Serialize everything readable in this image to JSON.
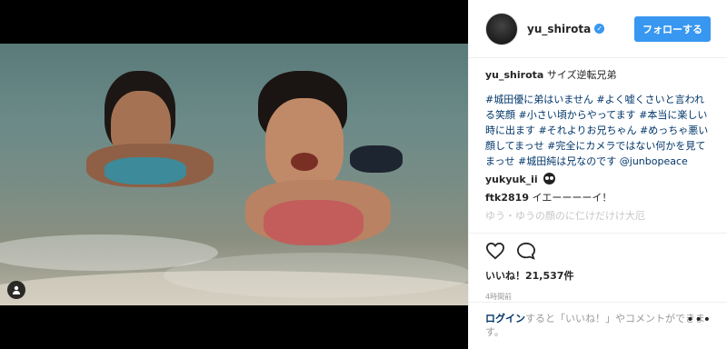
{
  "post": {
    "username": "yu_shirota",
    "verified_icon": "verified-check-icon",
    "follow_label": "フォローする",
    "caption_user": "yu_shirota",
    "caption_text": " サイズ逆転兄弟",
    "hashtags": "#城田優に弟はいません #よく嘘くさいと言われる笑顔 #小さい頃からやってます #本当に楽しい時に出ます #それよりお兄ちゃん #めっちゃ悪い顔してまっせ #完全にカメラではない何かを見てまっせ #城田純は兄なのです @junbopeace",
    "comments": [
      {
        "user": "yukyuk_ii",
        "text": "",
        "emoji": "grinning-face-emoji"
      },
      {
        "user": "ftk2819",
        "text": " イエーーーーイ！"
      },
      {
        "user": "",
        "text": "ゆう・ゆうの顔のに仁けだけけ大厄"
      }
    ],
    "likes_label": "いいね！21,537件",
    "time_ago": "4時間前",
    "login_link": "ログイン",
    "login_text": "すると「いいね！」やコメントができます。",
    "more_label": "•••"
  },
  "colors": {
    "accent": "#3897f0",
    "hashtag": "#003569"
  }
}
